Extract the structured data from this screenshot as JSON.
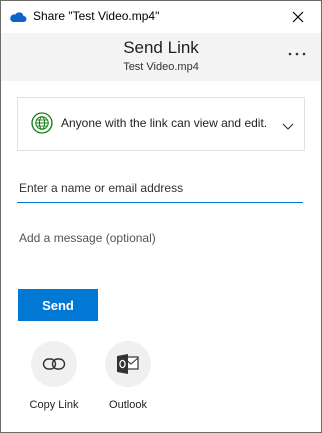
{
  "window": {
    "title": "Share \"Test Video.mp4\"",
    "close_icon": "close-icon",
    "app_icon": "onedrive-cloud-icon"
  },
  "header": {
    "heading": "Send Link",
    "subheading": "Test Video.mp4",
    "more_icon": "more-ellipsis-icon"
  },
  "permission": {
    "label": "Anyone with the link can view and edit.",
    "icon": "globe-icon",
    "accent": "#107c10"
  },
  "email_field": {
    "placeholder": "Enter a name or email address",
    "value": ""
  },
  "message_field": {
    "placeholder": "Add a message (optional)",
    "value": ""
  },
  "send_button": {
    "label": "Send",
    "color": "#0078d4"
  },
  "share_targets": [
    {
      "label": "Copy Link",
      "icon": "link-icon"
    },
    {
      "label": "Outlook",
      "icon": "outlook-icon"
    }
  ]
}
